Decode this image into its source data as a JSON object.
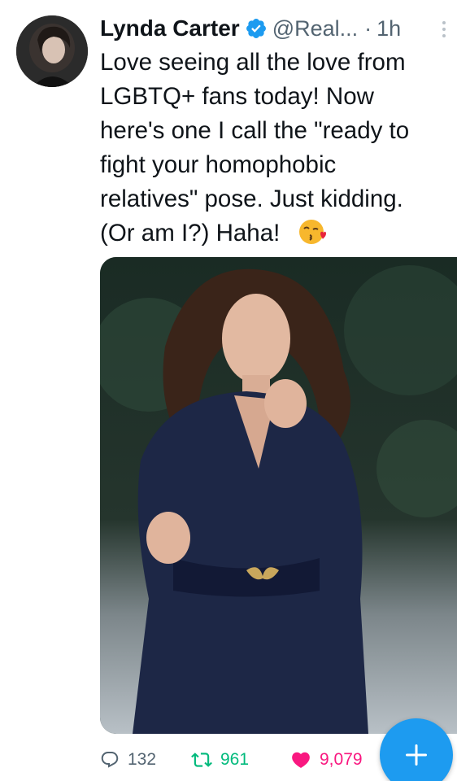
{
  "tweet": {
    "author": {
      "display_name": "Lynda Carter",
      "handle": "@Real...",
      "verified": true,
      "avatar": "profile-photo"
    },
    "separator": "·",
    "time": "1h",
    "text": "Love seeing all the love from\nLGBTQ+ fans today! Now\nhere's one I call the \"ready to\nfight your homophobic\nrelatives\" pose. Just kidding.\n(Or am I?) Haha!",
    "emoji": "face-blowing-a-kiss",
    "media": "photo-woman-in-navy-dress-boxing-pose"
  },
  "actions": {
    "reply_count": "132",
    "retweet_count": "961",
    "like_count": "9,079"
  },
  "icons": {
    "verified": "verified-badge-icon",
    "more": "more-vertical-icon",
    "reply": "reply-icon",
    "retweet": "retweet-icon",
    "like": "heart-icon",
    "compose": "plus-icon"
  },
  "colors": {
    "accent": "#1d9bf0",
    "retweet": "#00ba7c",
    "like": "#f91880",
    "secondary_text": "#536471",
    "primary_text": "#0f1419"
  }
}
